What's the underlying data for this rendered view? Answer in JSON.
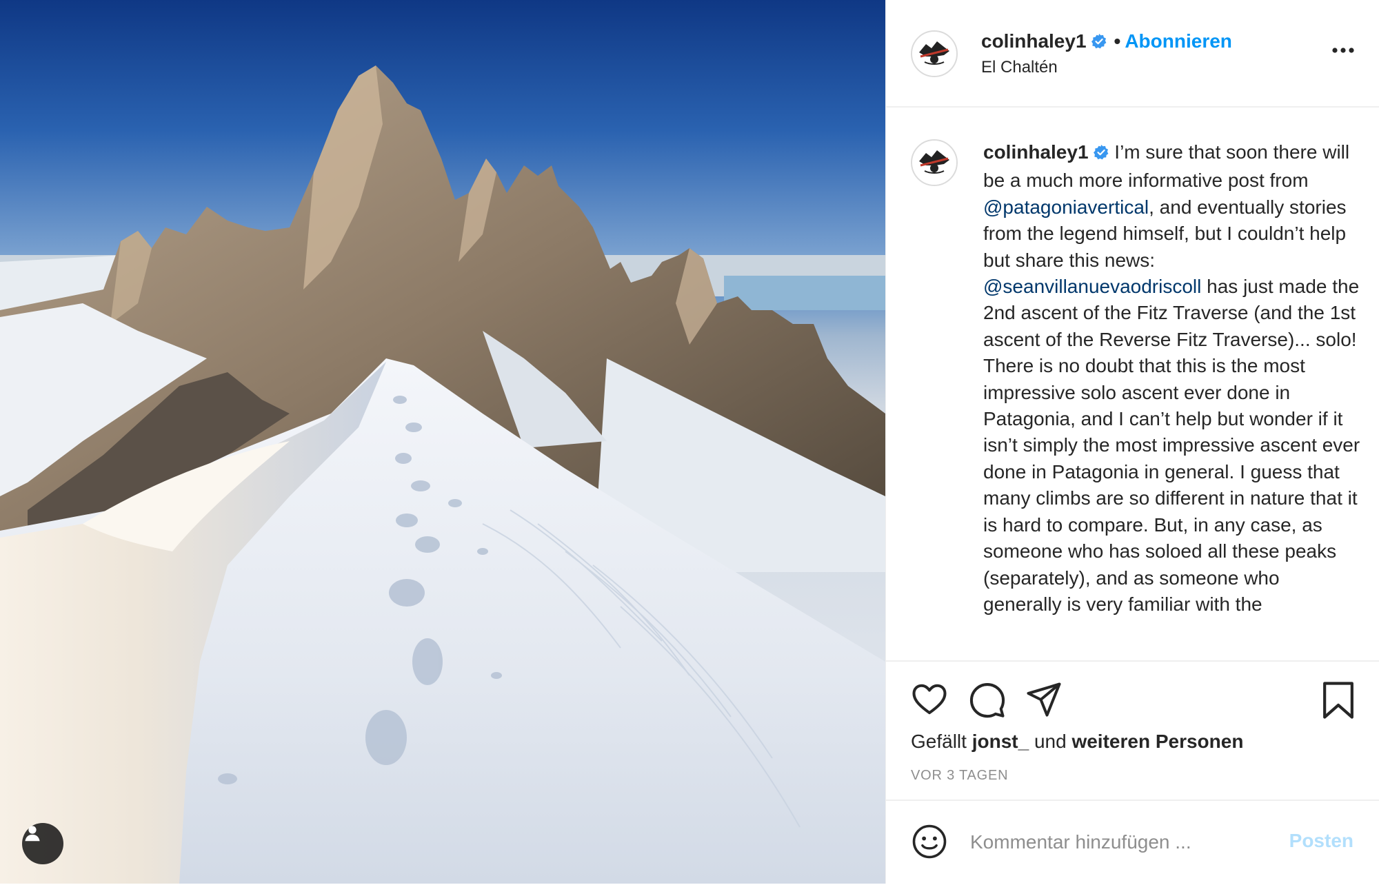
{
  "colors": {
    "accent_blue": "#0095f6",
    "mention_blue": "#00376b",
    "post_disabled": "#b2dffc",
    "muted_text": "#8e8e8e",
    "text": "#262626"
  },
  "photo": {
    "icon": "user-tag-icon"
  },
  "header": {
    "username": "colinhaley1",
    "verified_icon": "verified-badge-icon",
    "separator": "•",
    "follow_label": "Abonnieren",
    "location": "El Chaltén",
    "more_icon": "more-options-icon"
  },
  "caption": {
    "username": "colinhaley1",
    "text_1": " I’m sure that soon there will be a much more informative post from ",
    "mention_1": "@patagoniavertical",
    "text_2": ", and eventually stories from the legend himself, but I couldn’t help but share this news: ",
    "mention_2": "@seanvillanuevaodriscoll",
    "text_3": " has just made the 2nd ascent of the Fitz Traverse (and the 1st ascent of the Reverse Fitz Traverse)... solo! There is no doubt that this is the most impressive solo ascent ever done in Patagonia, and I can’t help but wonder if it isn’t simply the most impressive ascent ever done in Patagonia in general. I guess that many climbs are so different in nature that it is hard to compare. But, in any case, as someone who has soloed all these peaks (separately), and as someone who generally is very familiar with the"
  },
  "actions": {
    "icons": [
      "heart-icon",
      "comment-icon",
      "share-icon",
      "bookmark-icon"
    ],
    "likes_prefix": "Gefällt ",
    "likes_user": "jonst_",
    "likes_mid": " und ",
    "likes_suffix": "weiteren Personen",
    "timestamp": "VOR 3 TAGEN"
  },
  "comment_bar": {
    "emoji_icon": "emoji-icon",
    "placeholder": "Kommentar hinzufügen ...",
    "post_label": "Posten"
  }
}
